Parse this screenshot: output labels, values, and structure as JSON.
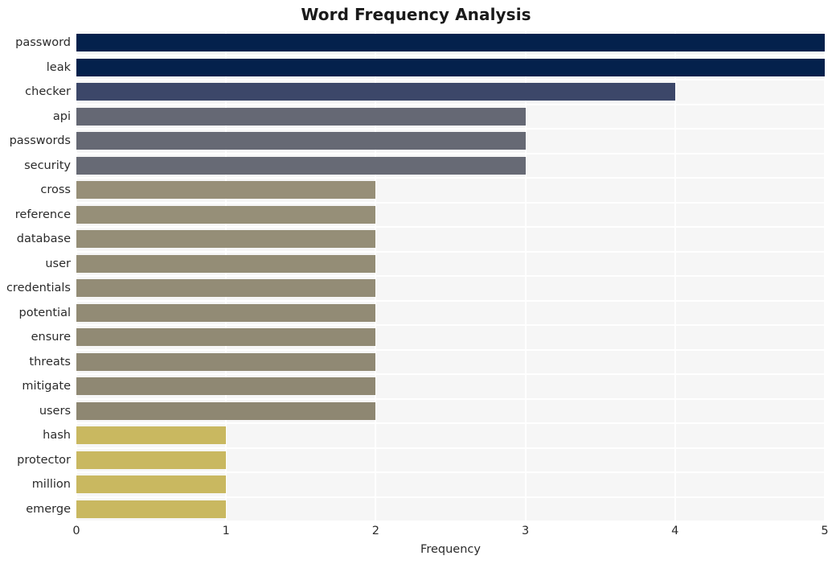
{
  "chart_data": {
    "type": "bar",
    "orientation": "horizontal",
    "title": "Word Frequency Analysis",
    "xlabel": "Frequency",
    "ylabel": "",
    "xlim": [
      0,
      5
    ],
    "xticks": [
      0,
      1,
      2,
      3,
      4,
      5
    ],
    "xtick_labels": [
      "0",
      "1",
      "2",
      "3",
      "4",
      "5"
    ],
    "grid": true,
    "grid_color": "#ffffff",
    "plot_background": "#f6f6f6",
    "figure_background": "#ffffff",
    "legend": null,
    "categories": [
      "password",
      "leak",
      "checker",
      "api",
      "passwords",
      "security",
      "cross",
      "reference",
      "database",
      "user",
      "credentials",
      "potential",
      "ensure",
      "threats",
      "mitigate",
      "users",
      "hash",
      "protector",
      "million",
      "emerge"
    ],
    "values": [
      5,
      5,
      4,
      3,
      3,
      3,
      2,
      2,
      2,
      2,
      2,
      2,
      2,
      2,
      2,
      2,
      1,
      1,
      1,
      1
    ],
    "bar_colors": [
      "#04214c",
      "#04214c",
      "#3c4769",
      "#656874",
      "#666974",
      "#676a75",
      "#978f78",
      "#968f78",
      "#958e77",
      "#948d76",
      "#938c76",
      "#928b75",
      "#918a74",
      "#908974",
      "#8f8873",
      "#8e8772",
      "#c9b860",
      "#c9b860",
      "#c9b860",
      "#c9b860"
    ]
  }
}
